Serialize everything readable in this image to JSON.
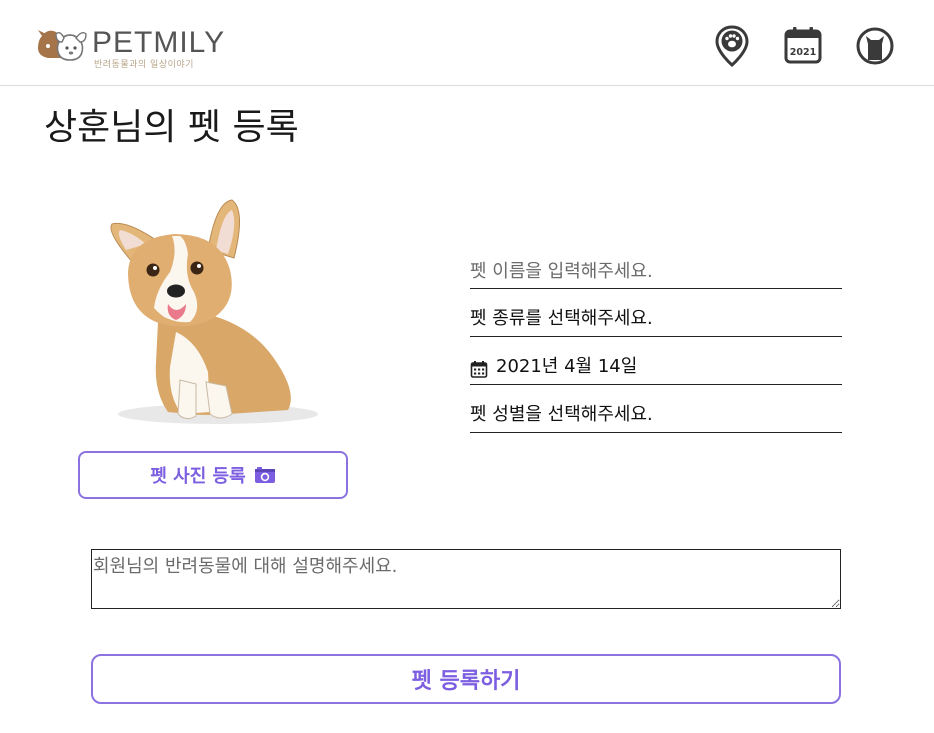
{
  "header": {
    "logo_text": "PETMILY",
    "logo_subtitle": "반려동물과의 일상이야기",
    "icons": [
      "map-paw-pin-icon",
      "calendar-icon",
      "profile-icon"
    ],
    "calendar_year": "2021"
  },
  "page": {
    "title": "상훈님의 펫 등록"
  },
  "photo": {
    "button_label": "펫 사진 등록"
  },
  "form": {
    "name_placeholder": "펫 이름을 입력해주세요.",
    "type_label": "펫 종류를 선택해주세요.",
    "date_label": "2021년 4월 14일",
    "gender_label": "펫 성별을 선택해주세요."
  },
  "description": {
    "placeholder": "회원님의 반려동물에 대해 설명해주세요."
  },
  "submit": {
    "label": "펫 등록하기"
  },
  "colors": {
    "accent": "#7c5fe0",
    "border": "#8b72e0"
  }
}
